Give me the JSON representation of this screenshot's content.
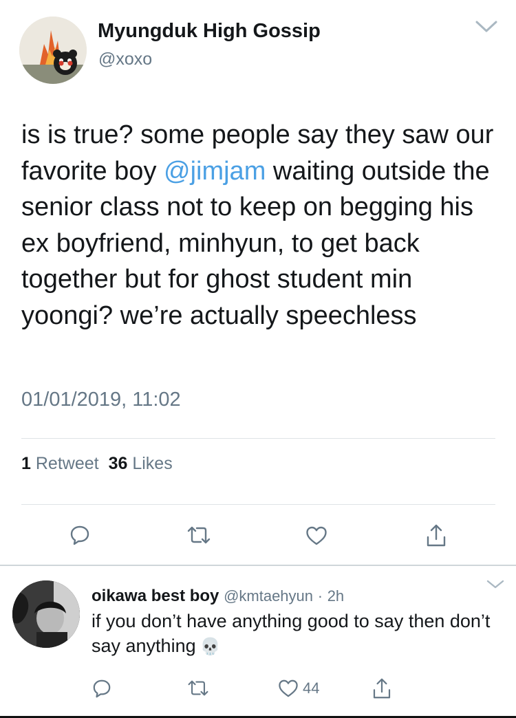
{
  "tweet": {
    "display_name": "Myungduk High Gossip",
    "handle": "@xoxo",
    "text_before_mention": "is is true? some people say they saw our favorite boy ",
    "mention": "@jimjam",
    "text_after_mention": " waiting outside the senior class not to keep on begging his ex boyfriend, minhyun, to get back together but for ghost student min yoongi? we’re actually speechless",
    "timestamp": "01/01/2019, 11:02",
    "retweet_count": "1",
    "retweet_label": "Retweet",
    "like_count": "36",
    "like_label": "Likes"
  },
  "actions": {
    "icons": [
      "reply-icon",
      "retweet-icon",
      "like-icon",
      "share-icon"
    ],
    "color": "#657786"
  },
  "reply": {
    "display_name": "oikawa best boy",
    "handle": "@kmtaehyun",
    "separator": "·",
    "time": "2h",
    "text": "if you don’t have anything good to say then don’t say anything",
    "emoji": "💀",
    "like_count": "44"
  },
  "colors": {
    "text": "#14171a",
    "muted": "#657786",
    "link": "#4ba0e4",
    "divider": "#dfe3e6"
  }
}
